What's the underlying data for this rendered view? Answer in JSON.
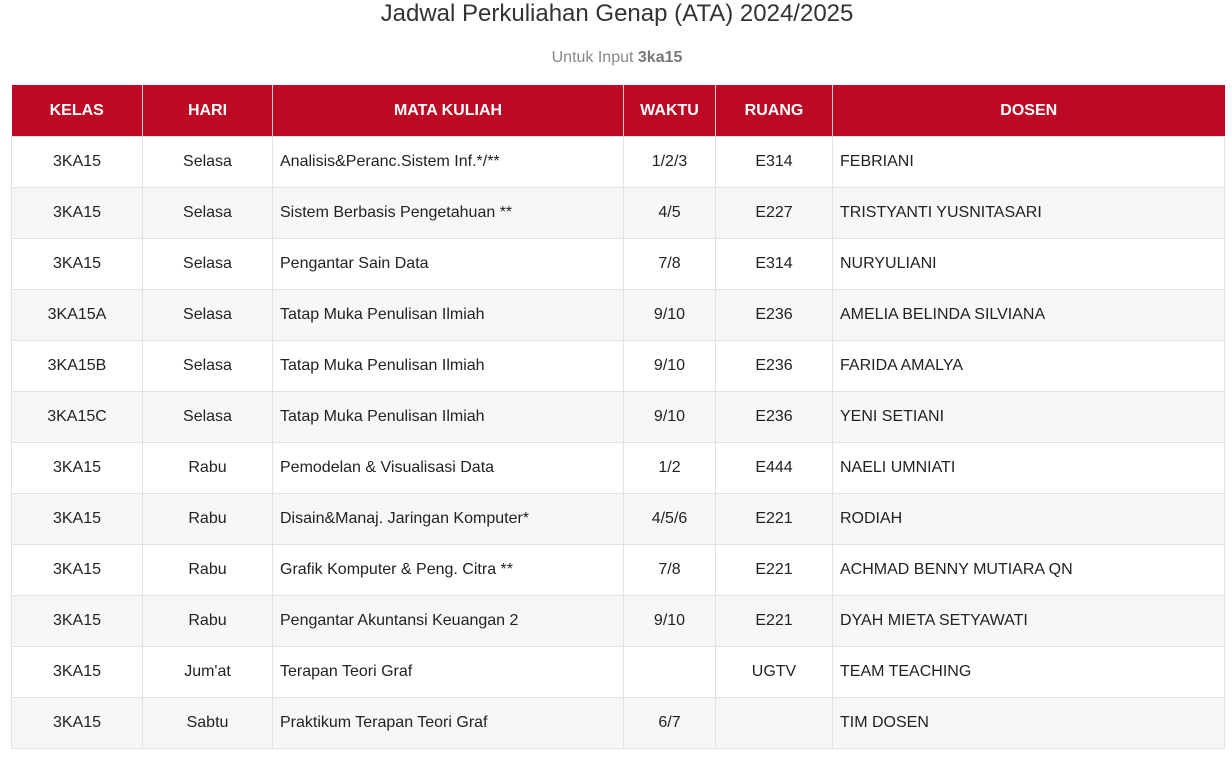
{
  "title": "Jadwal Perkuliahan Genap (ATA) 2024/2025",
  "subtitle": {
    "prefix": "Untuk Input",
    "value": "3ka15"
  },
  "table": {
    "headers": [
      "KELAS",
      "HARI",
      "MATA KULIAH",
      "WAKTU",
      "RUANG",
      "DOSEN"
    ],
    "rows": [
      [
        "3KA15",
        "Selasa",
        "Analisis&Peranc.Sistem Inf.*/**",
        "1/2/3",
        "E314",
        "FEBRIANI"
      ],
      [
        "3KA15",
        "Selasa",
        "Sistem Berbasis Pengetahuan **",
        "4/5",
        "E227",
        "TRISTYANTI YUSNITASARI"
      ],
      [
        "3KA15",
        "Selasa",
        "Pengantar Sain Data",
        "7/8",
        "E314",
        "NURYULIANI"
      ],
      [
        "3KA15A",
        "Selasa",
        "Tatap Muka Penulisan Ilmiah",
        "9/10",
        "E236",
        "AMELIA BELINDA SILVIANA"
      ],
      [
        "3KA15B",
        "Selasa",
        "Tatap Muka Penulisan Ilmiah",
        "9/10",
        "E236",
        "FARIDA AMALYA"
      ],
      [
        "3KA15C",
        "Selasa",
        "Tatap Muka Penulisan Ilmiah",
        "9/10",
        "E236",
        "YENI SETIANI"
      ],
      [
        "3KA15",
        "Rabu",
        "Pemodelan & Visualisasi Data",
        "1/2",
        "E444",
        "NAELI UMNIATI"
      ],
      [
        "3KA15",
        "Rabu",
        "Disain&Manaj. Jaringan Komputer*",
        "4/5/6",
        "E221",
        "RODIAH"
      ],
      [
        "3KA15",
        "Rabu",
        "Grafik Komputer & Peng. Citra **",
        "7/8",
        "E221",
        "ACHMAD BENNY MUTIARA QN"
      ],
      [
        "3KA15",
        "Rabu",
        "Pengantar Akuntansi Keuangan 2",
        "9/10",
        "E221",
        "DYAH MIETA SETYAWATI"
      ],
      [
        "3KA15",
        "Jum'at",
        "Terapan Teori Graf",
        "",
        "UGTV",
        "TEAM TEACHING"
      ],
      [
        "3KA15",
        "Sabtu",
        "Praktikum Terapan Teori Graf",
        "6/7",
        "",
        "TIM DOSEN"
      ]
    ]
  },
  "colors": {
    "header_bg": "#bd0a24",
    "header_text": "#ffffff",
    "row_alt_bg": "#f7f7f7"
  }
}
